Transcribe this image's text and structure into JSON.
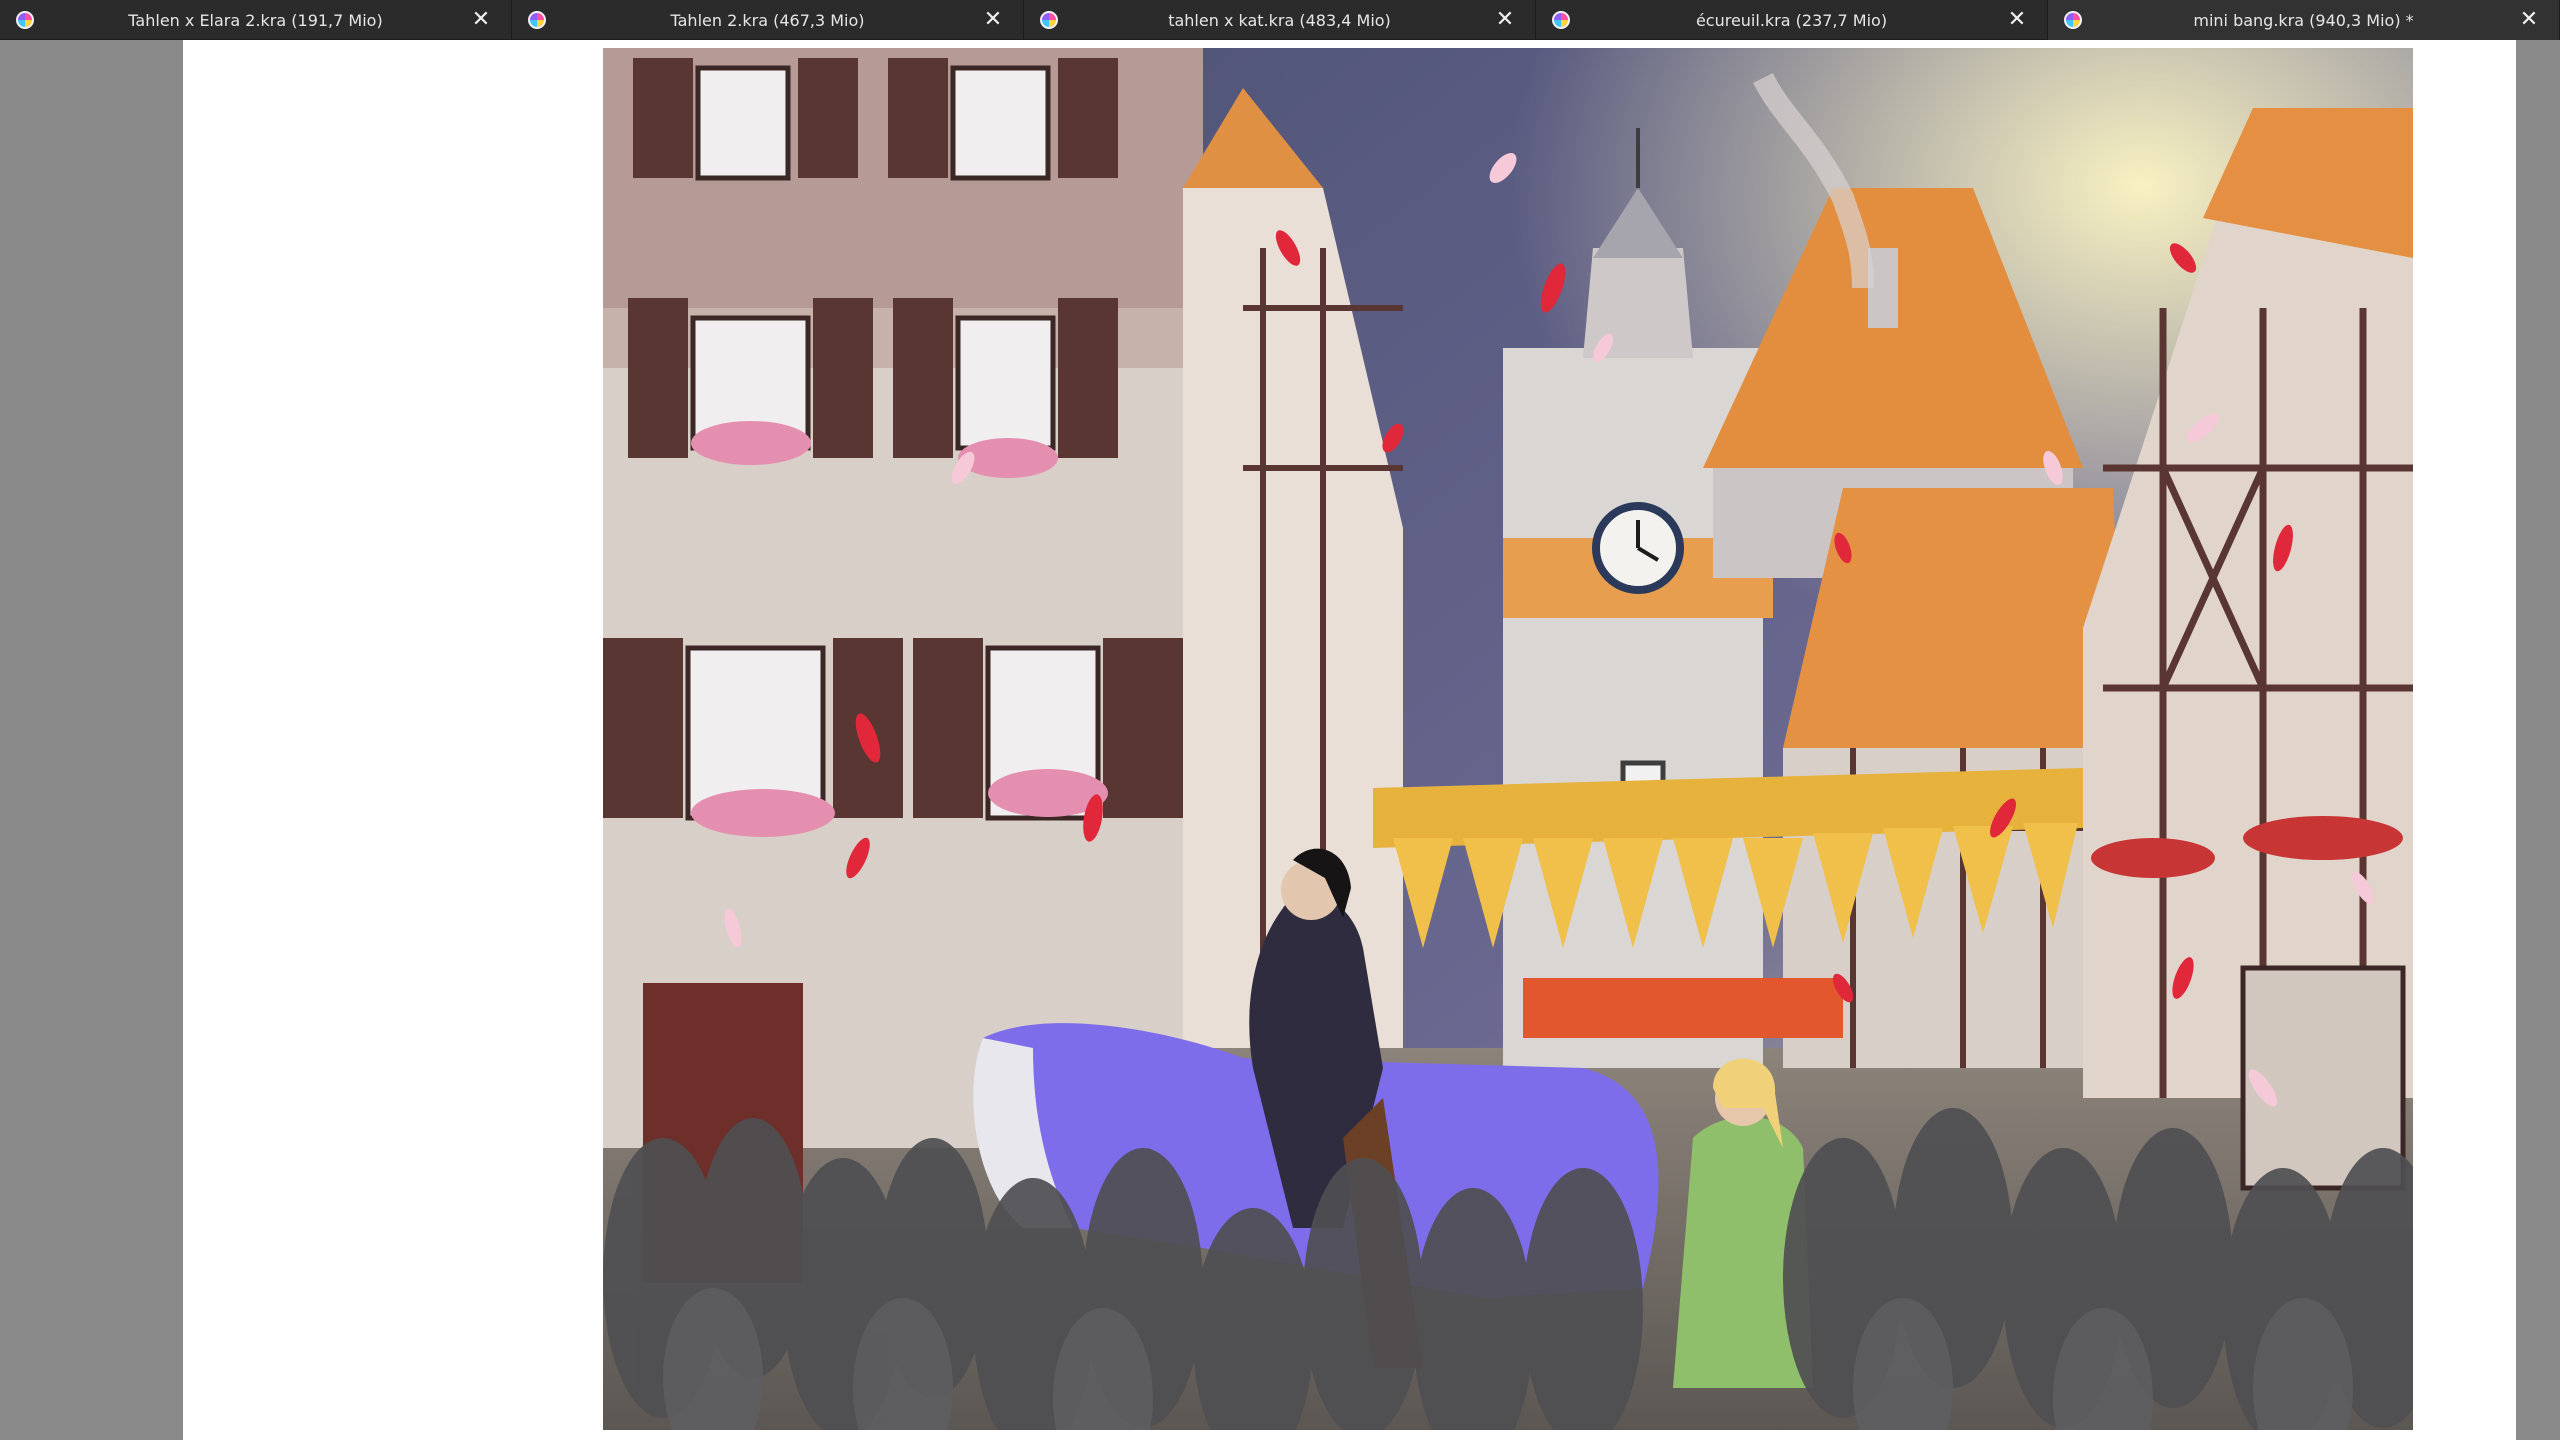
{
  "tabs": [
    {
      "title": "Tahlen x Elara 2.kra (191,7 Mio)",
      "active": false
    },
    {
      "title": "Tahlen 2.kra (467,3 Mio)",
      "active": false
    },
    {
      "title": "tahlen x kat.kra (483,4 Mio)",
      "active": false
    },
    {
      "title": "écureuil.kra (237,7 Mio)",
      "active": false
    },
    {
      "title": "mini bang.kra (940,3 Mio) *",
      "active": true
    }
  ],
  "icons": {
    "tab_app": "krita-icon",
    "tab_close": "close-icon"
  },
  "glyphs": {
    "close": "✕"
  },
  "colors": {
    "tabbar_bg": "#2b2b2b",
    "canvas_bg": "#8a8a8a",
    "paper": "#ffffff"
  }
}
